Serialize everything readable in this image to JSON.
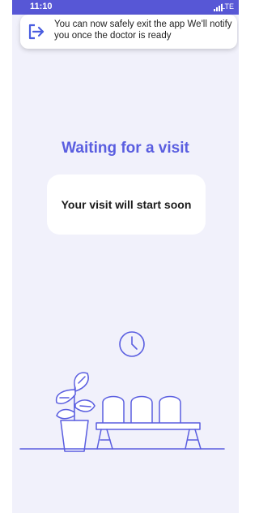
{
  "status_bar": {
    "time": "11:10",
    "network": "LTE"
  },
  "notification": {
    "icon": "exit-icon",
    "message": "You can now safely exit the app We'll notify you once the doctor is ready"
  },
  "title": "Waiting for a visit",
  "card": {
    "text": "Your visit will start soon"
  },
  "illustration": {
    "icons": [
      "clock-icon",
      "plant-icon",
      "bench-icon"
    ]
  },
  "colors": {
    "accent": "#5a5ee0",
    "status_bar": "#5757d6",
    "background": "#f1f1fb"
  }
}
